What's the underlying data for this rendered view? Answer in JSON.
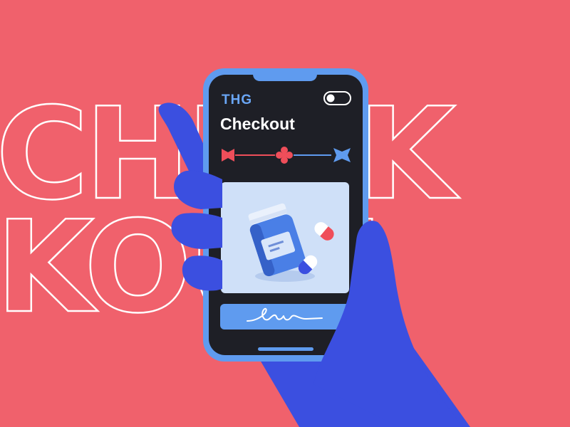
{
  "background": {
    "color": "#F0616C",
    "outline_text_top": "CHECK",
    "outline_text_bottom": "KOUT"
  },
  "phone": {
    "brand": "THG",
    "screen_title": "Checkout",
    "toggle_state": "on",
    "progress_steps": [
      "bow-icon",
      "flower-icon",
      "ribbon-icon"
    ],
    "signature_button_icon": "signature-icon"
  },
  "colors": {
    "accent_blue": "#5F9BEF",
    "hand_blue": "#3B4FE0",
    "screen_dark": "#1E1F26",
    "card_bg": "#CFE0F8",
    "brand_text": "#6AA6F5",
    "red": "#EF4E5A"
  }
}
